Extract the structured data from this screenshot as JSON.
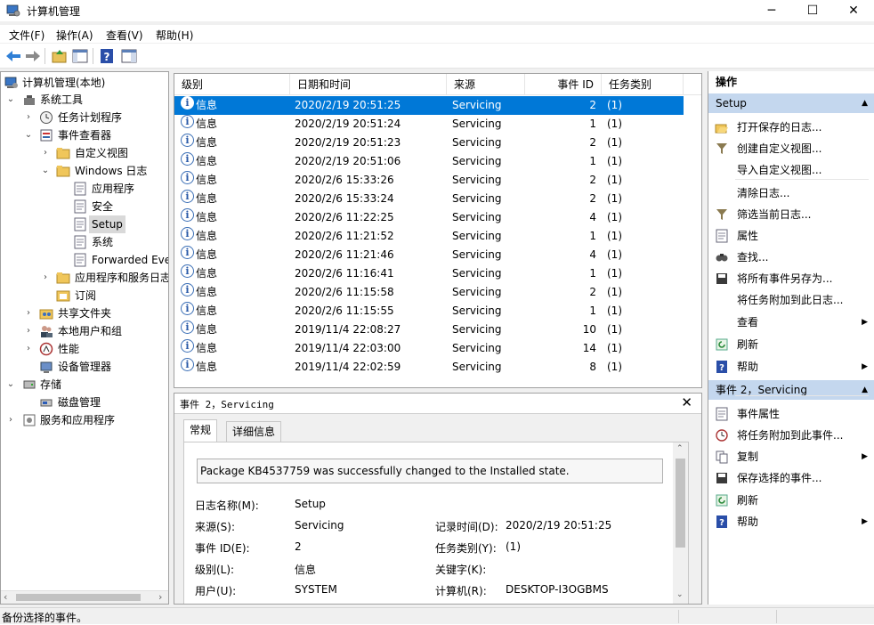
{
  "window": {
    "title": "计算机管理",
    "minimize": "─",
    "maximize": "☐",
    "close": "✕"
  },
  "menu": [
    "文件(F)",
    "操作(A)",
    "查看(V)",
    "帮助(H)"
  ],
  "tree": {
    "root": "计算机管理(本地)",
    "system_tools": "系统工具",
    "task_scheduler": "任务计划程序",
    "event_viewer": "事件查看器",
    "custom_views": "自定义视图",
    "windows_logs": "Windows 日志",
    "application": "应用程序",
    "security": "安全",
    "setup": "Setup",
    "system": "系统",
    "forwarded": "Forwarded Eve",
    "app_service_logs": "应用程序和服务日志",
    "subscriptions": "订阅",
    "shared_folders": "共享文件夹",
    "local_users": "本地用户和组",
    "performance": "性能",
    "device_manager": "设备管理器",
    "storage": "存储",
    "disk_management": "磁盘管理",
    "services_apps": "服务和应用程序"
  },
  "list": {
    "columns": [
      "级别",
      "日期和时间",
      "来源",
      "事件 ID",
      "任务类别"
    ],
    "rows": [
      {
        "level": "信息",
        "datetime": "2020/2/19 20:51:25",
        "source": "Servicing",
        "id": "2",
        "task": "(1)"
      },
      {
        "level": "信息",
        "datetime": "2020/2/19 20:51:24",
        "source": "Servicing",
        "id": "1",
        "task": "(1)"
      },
      {
        "level": "信息",
        "datetime": "2020/2/19 20:51:23",
        "source": "Servicing",
        "id": "2",
        "task": "(1)"
      },
      {
        "level": "信息",
        "datetime": "2020/2/19 20:51:06",
        "source": "Servicing",
        "id": "1",
        "task": "(1)"
      },
      {
        "level": "信息",
        "datetime": "2020/2/6 15:33:26",
        "source": "Servicing",
        "id": "2",
        "task": "(1)"
      },
      {
        "level": "信息",
        "datetime": "2020/2/6 15:33:24",
        "source": "Servicing",
        "id": "2",
        "task": "(1)"
      },
      {
        "level": "信息",
        "datetime": "2020/2/6 11:22:25",
        "source": "Servicing",
        "id": "4",
        "task": "(1)"
      },
      {
        "level": "信息",
        "datetime": "2020/2/6 11:21:52",
        "source": "Servicing",
        "id": "1",
        "task": "(1)"
      },
      {
        "level": "信息",
        "datetime": "2020/2/6 11:21:46",
        "source": "Servicing",
        "id": "4",
        "task": "(1)"
      },
      {
        "level": "信息",
        "datetime": "2020/2/6 11:16:41",
        "source": "Servicing",
        "id": "1",
        "task": "(1)"
      },
      {
        "level": "信息",
        "datetime": "2020/2/6 11:15:58",
        "source": "Servicing",
        "id": "2",
        "task": "(1)"
      },
      {
        "level": "信息",
        "datetime": "2020/2/6 11:15:55",
        "source": "Servicing",
        "id": "1",
        "task": "(1)"
      },
      {
        "level": "信息",
        "datetime": "2019/11/4 22:08:27",
        "source": "Servicing",
        "id": "10",
        "task": "(1)"
      },
      {
        "level": "信息",
        "datetime": "2019/11/4 22:03:00",
        "source": "Servicing",
        "id": "14",
        "task": "(1)"
      },
      {
        "level": "信息",
        "datetime": "2019/11/4 22:02:59",
        "source": "Servicing",
        "id": "8",
        "task": "(1)"
      }
    ]
  },
  "detail": {
    "header": "事件 2，Servicing",
    "close": "✕",
    "tabs": [
      "常规",
      "详细信息"
    ],
    "description": "Package KB4537759 was successfully changed to the Installed state.",
    "log_name_label": "日志名称(M):",
    "log_name": "Setup",
    "source_label": "来源(S):",
    "source": "Servicing",
    "logged_label": "记录时间(D):",
    "logged": "2020/2/19 20:51:25",
    "event_id_label": "事件 ID(E):",
    "event_id": "2",
    "task_label": "任务类别(Y):",
    "task": "(1)",
    "level_label": "级别(L):",
    "level": "信息",
    "keywords_label": "关键字(K):",
    "user_label": "用户(U):",
    "user": "SYSTEM",
    "computer_label": "计算机(R):",
    "computer": "DESKTOP-I3OGBMS"
  },
  "actions": {
    "title": "操作",
    "section1": "Setup",
    "s1": [
      "打开保存的日志...",
      "创建自定义视图...",
      "导入自定义视图...",
      "清除日志...",
      "筛选当前日志...",
      "属性",
      "查找...",
      "将所有事件另存为...",
      "将任务附加到此日志...",
      "查看",
      "刷新",
      "帮助"
    ],
    "section2": "事件 2，Servicing",
    "s2": [
      "事件属性",
      "将任务附加到此事件...",
      "复制",
      "保存选择的事件...",
      "刷新",
      "帮助"
    ]
  },
  "status": "备份选择的事件。",
  "colors": {
    "selection": "#0078d7",
    "section_header": "#c4d7ee",
    "inactive_selection": "#d9d9d9"
  }
}
